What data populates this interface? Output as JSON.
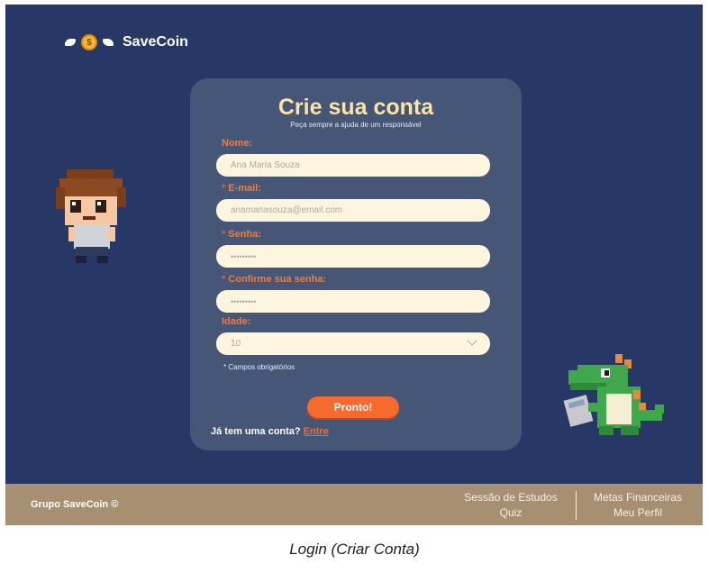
{
  "brand": {
    "name": "SaveCoin",
    "coin_symbol": "$"
  },
  "form": {
    "title": "Crie sua conta",
    "subtitle": "Peça sempre a ajuda de um responsável",
    "name": {
      "label": "Nome:",
      "placeholder": "Ana Maria Souza"
    },
    "email": {
      "required_mark": "*",
      "label": "E-mail:",
      "placeholder": "anamariasouza@email.com"
    },
    "password": {
      "required_mark": "*",
      "label": "Senha:",
      "masked": "•••••••••"
    },
    "confirm": {
      "required_mark": "*",
      "label": "Confirme sua senha:",
      "masked": "•••••••••"
    },
    "age": {
      "label": "Idade:",
      "selected": "10"
    },
    "required_note": "* Campos obrigatórios",
    "submit_label": "Pronto!",
    "has_account_text": "Já tem uma conta?",
    "login_link": "Entre"
  },
  "footer": {
    "brand": "Grupo SaveCoin ©",
    "links_col1": [
      "Sessão de Estudos",
      "Quiz"
    ],
    "links_col2": [
      "Metas Financeiras",
      "Meu Perfil"
    ]
  },
  "caption": "Login (Criar Conta)",
  "colors": {
    "background": "#273866",
    "card": "#465677",
    "accent": "#f66a2d",
    "title": "#fde3a6",
    "field": "#fdf5dd",
    "footer": "#a78f72"
  }
}
